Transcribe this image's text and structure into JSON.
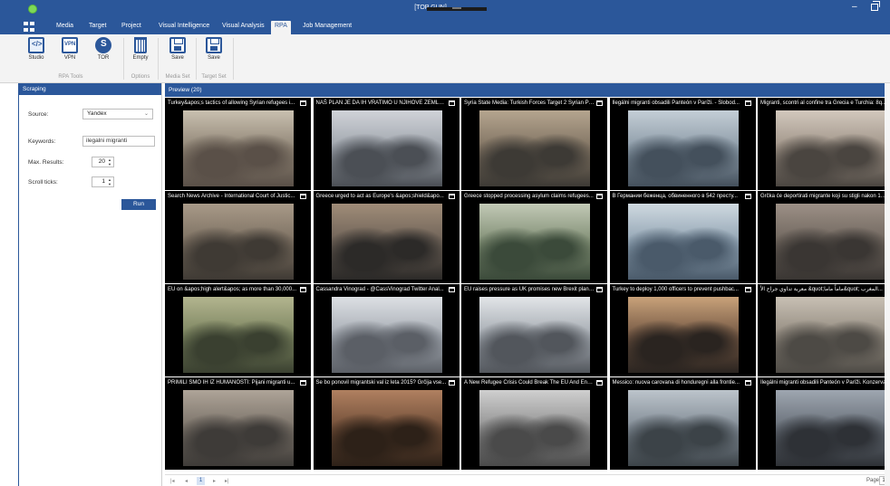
{
  "window": {
    "title": "[TOP GUN]",
    "minimize_icon": "minimize-icon",
    "restore_icon": "restore-icon"
  },
  "menu": {
    "tabs": [
      {
        "label": "Media"
      },
      {
        "label": "Target"
      },
      {
        "label": "Project"
      },
      {
        "label": "Visual Intelligence"
      },
      {
        "label": "Visual Analysis"
      },
      {
        "label": "RPA",
        "active": true
      },
      {
        "label": "Job Management"
      }
    ]
  },
  "ribbon": {
    "studio": "Studio",
    "vpn": "VPN",
    "tor": "TOR",
    "empty": "Empty",
    "save_media": "Save",
    "save_target": "Save",
    "groups": {
      "rpa_tools": "RPA Tools",
      "options": "Options",
      "media_set": "Media Set",
      "target_set": "Target Set"
    }
  },
  "scraping": {
    "title": "Scraping",
    "source_label": "Source:",
    "source_value": "Yandex",
    "keywords_label": "Keywords:",
    "keywords_value": "ilegalni migranti",
    "max_results_label": "Max. Results:",
    "max_results_value": "20",
    "scroll_ticks_label": "Scroll ticks:",
    "scroll_ticks_value": "1",
    "run_label": "Run"
  },
  "preview": {
    "title": "Preview (20)",
    "items": [
      {
        "caption": "Turkey&apos;s tactics of allowing Syrian refugees i..."
      },
      {
        "caption": "NAŠ PLAN JE DA IH VRATIMO U NJIHOVE ZEMLJE..."
      },
      {
        "caption": "Syria State Media: Turkish Forces Target 2 Syrian Pla..."
      },
      {
        "caption": "Ilegálni migranti obsadili Panteón v Paríži. - Slobod..."
      },
      {
        "caption": "Migranti, scontri al confine tra Grecia e Turchia: 8q..."
      },
      {
        "caption": "Search News Archive - International Court of Justic..."
      },
      {
        "caption": "Greece urged to act as Europe's &apos;shield&apo..."
      },
      {
        "caption": "Greece stopped processing asylum claims refugees..."
      },
      {
        "caption": "В Германии беженца, обвиненного в 542 престу..."
      },
      {
        "caption": "Grčka će deportirati migrante koji su stigli nakon 1..."
      },
      {
        "caption": "EU on &apos;high alert&apos; as more than 30,000..."
      },
      {
        "caption": "Cassandra Vinograd - @CassVinograd Twitter Anal..."
      },
      {
        "caption": "EU raises pressure as UK promises new Brexit plans..."
      },
      {
        "caption": "Turkey to deploy 1,000 officers to prevent pushbac..."
      },
      {
        "caption": "معربة تداوي جراح الأ &quot;ماماً ماما&quot; المغرب..."
      },
      {
        "caption": "PRIMILI SMO IH IZ HUMANOSTI: Pijani migranti u..."
      },
      {
        "caption": "Se bo ponovil migrantski val iz leta 2015? Grčija vse..."
      },
      {
        "caption": "A New Refugee Crisis Could Break The EU And End..."
      },
      {
        "caption": "Messico: nuova carovana di honduregni alla frontie..."
      },
      {
        "caption": "Ilegálni migranti obsadili Panteón v Paríži. Konzerva..."
      }
    ]
  },
  "pager": {
    "first": "|◂",
    "prev": "◂",
    "current": "1",
    "next": "▸",
    "last": "▸|",
    "page_label": "Page",
    "page_value": "1"
  },
  "colors": {
    "accent": "#2b579a",
    "app_dot": "#7ed957"
  }
}
